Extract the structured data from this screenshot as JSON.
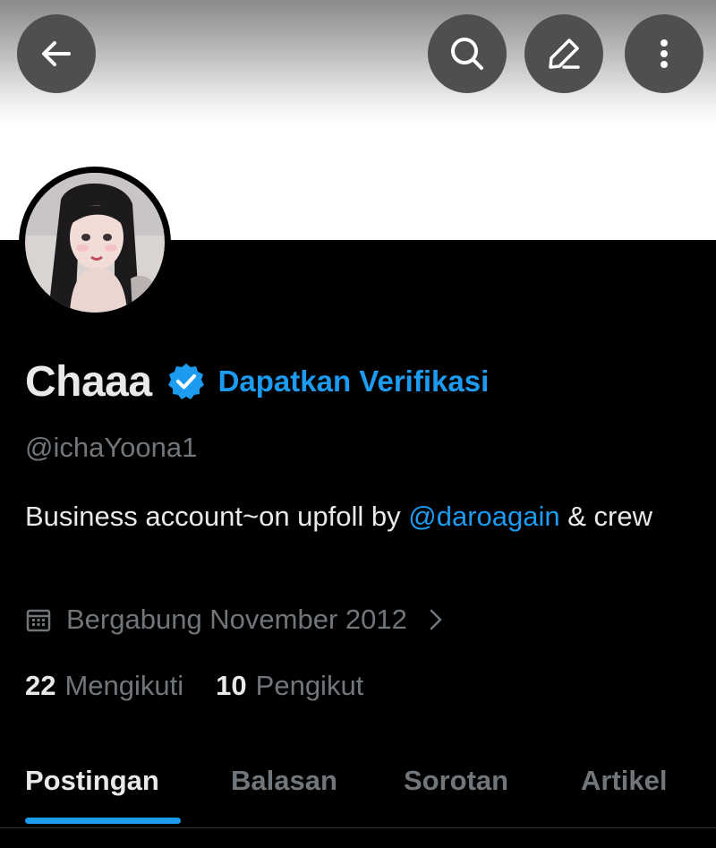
{
  "header": {
    "back_icon": "arrow-left-icon",
    "search_icon": "search-icon",
    "edit_icon": "pencil-icon",
    "more_icon": "vertical-ellipsis-icon"
  },
  "profile": {
    "display_name": "Chaaa",
    "verified_icon": "verified-badge-icon",
    "verified_color": "#1d9bf0",
    "get_verified_label": "Dapatkan Verifikasi",
    "handle": "@ichaYoona1",
    "bio_before": "Business account~on upfoll by ",
    "bio_mention": "@daroagain",
    "bio_after": " & crew",
    "joined_icon": "calendar-icon",
    "joined_text": "Bergabung November 2012",
    "following_count": "22",
    "following_label": "Mengikuti",
    "followers_count": "10",
    "followers_label": "Pengikut"
  },
  "tabs": [
    {
      "label": "Postingan",
      "active": true
    },
    {
      "label": "Balasan",
      "active": false
    },
    {
      "label": "Sorotan",
      "active": false
    },
    {
      "label": "Artikel",
      "active": false
    }
  ],
  "colors": {
    "accent": "#1d9bf0",
    "background": "#000000",
    "text_primary": "#e7e9ea",
    "text_secondary": "#71767b"
  }
}
